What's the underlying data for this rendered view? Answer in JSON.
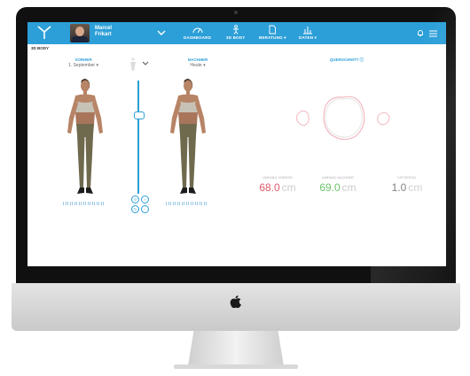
{
  "header": {
    "user_first": "Marcel",
    "user_last": "Frikart",
    "nav": [
      {
        "label": "DASHBOARD",
        "icon": "gauge-icon"
      },
      {
        "label": "3D BODY",
        "icon": "body-icon"
      },
      {
        "label": "BERATUNG ▾",
        "icon": "document-icon"
      },
      {
        "label": "DATEN ▾",
        "icon": "chart-icon"
      }
    ]
  },
  "page": {
    "section_label": "3D BODY",
    "before": {
      "title": "VORHER",
      "date": "1. September ▾"
    },
    "after": {
      "title": "NACHHER",
      "date": "Heute ▾"
    },
    "cross_section": {
      "title": "QUERSCHNITT ⓘ"
    }
  },
  "stats": [
    {
      "label": "UMFANG VORHER",
      "value": "68.0",
      "unit": "cm",
      "color": "#e05a6a"
    },
    {
      "label": "UMFANG NACHHER",
      "value": "69.0",
      "unit": "cm",
      "color": "#6cc36a"
    },
    {
      "label": "DIFFERENZ",
      "value": "1.0",
      "unit": "cm",
      "color": "#777777"
    }
  ],
  "colors": {
    "brand": "#2c9fd8",
    "before": "#e05a6a",
    "after": "#6cc36a"
  }
}
